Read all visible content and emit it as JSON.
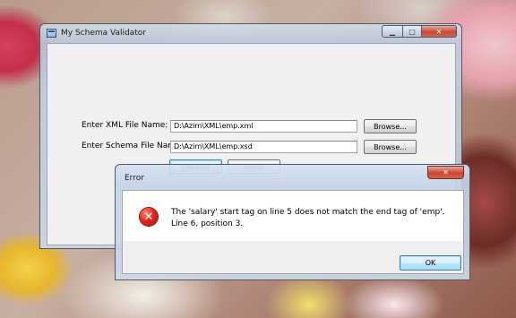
{
  "main_window": {
    "title": "My Schema Validator",
    "caption_buttons": {
      "minimize": "▁",
      "maximize": "▢",
      "close": "✕"
    },
    "form": {
      "xml_label": "Enter XML File Name:",
      "xml_value": "D:\\Azim\\XML\\emp.xml",
      "schema_label": "Enter Schema File Name:",
      "schema_value": "D:\\Azim\\XML\\emp.xsd",
      "browse_label": "Browse...",
      "validate_label": "Validate",
      "reset_label": "Reset"
    }
  },
  "error_dialog": {
    "title": "Error",
    "close_glyph": "✕",
    "icon_glyph": "✕",
    "message": "The 'salary' start tag on line 5 does not match the end tag of 'emp'. Line 6, position 3.",
    "ok_label": "OK"
  }
}
